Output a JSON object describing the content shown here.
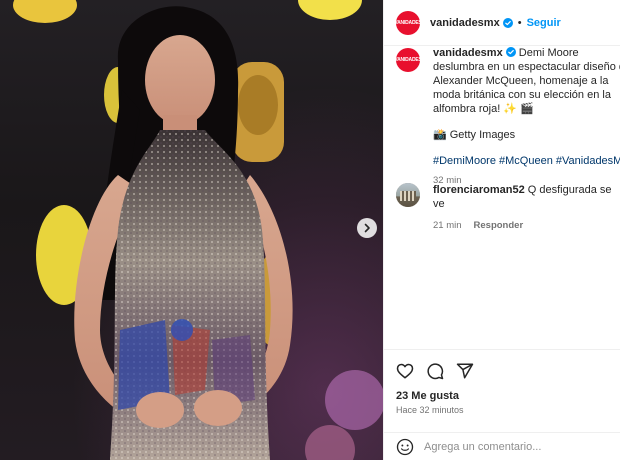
{
  "post": {
    "media": {
      "alt_icon": "carousel-next-icon"
    },
    "author": {
      "username": "vanidadesmx",
      "avatar_text": "VANIDADES",
      "separator": "•",
      "follow_label": "Seguir"
    },
    "caption": {
      "username": "vanidadesmx",
      "text": "Demi Moore deslumbra en un espectacular diseño de Alexander McQueen, homenaje a la moda británica con su elección en la alfombra roja! ✨ 🎬",
      "credit": "📸 Getty Images",
      "hashtags": "#DemiMoore #McQueen #VanidadesMx",
      "time": "32 min"
    },
    "comments": [
      {
        "username": "florenciaroman52",
        "text": "Q desfigurada se ve",
        "time": "21 min",
        "reply_label": "Responder"
      }
    ],
    "likes": "23 Me gusta",
    "posted_ago": "Hace 32 minutos",
    "comment_placeholder": "Agrega un comentario..."
  },
  "colors": {
    "accent_blue": "#0095f6",
    "brand_red": "#e8102e",
    "hashtag_blue": "#00376b"
  }
}
